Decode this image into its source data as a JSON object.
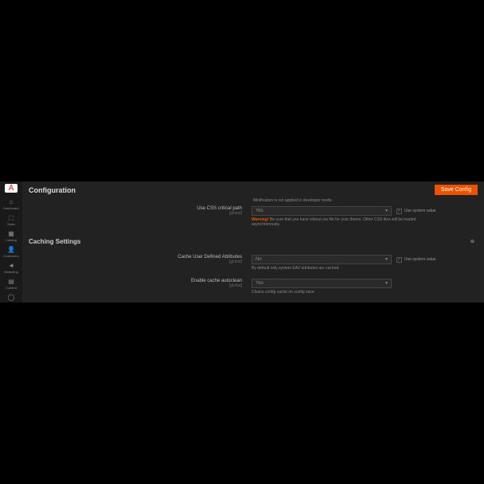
{
  "logo": "A",
  "sidebar": {
    "items": [
      {
        "icon": "⌂",
        "label": "Dashboard"
      },
      {
        "icon": "⬚",
        "label": "Sales"
      },
      {
        "icon": "▦",
        "label": "Catalog"
      },
      {
        "icon": "👤",
        "label": "Customers"
      },
      {
        "icon": "◄",
        "label": "Marketing"
      },
      {
        "icon": "▤",
        "label": "Content"
      },
      {
        "icon": "◯",
        "label": ""
      }
    ]
  },
  "header": {
    "title": "Configuration",
    "save_label": "Save Config"
  },
  "notice": "Minification is not applied in developer mode.",
  "fields": {
    "css_critical": {
      "label": "Use CSS critical path",
      "scope": "[global]",
      "value": "Yes",
      "checkbox_label": "Use system value",
      "warning_prefix": "Warning!",
      "warning_text": " Be sure that you have critical.css file for your theme. Other CSS files will be loaded asynchronously."
    },
    "cache_attrs": {
      "label": "Cache User Defined Attributes",
      "scope": "[global]",
      "value": "No",
      "checkbox_label": "Use system value",
      "help": "By default only system EAV attributes are cached."
    },
    "autoclean": {
      "label": "Enable cache autoclean",
      "scope": "[global]",
      "value": "Yes",
      "help": "Cleans config cache on config save"
    }
  },
  "section": {
    "title": "Caching Settings",
    "collapse_icon": "⊖"
  }
}
